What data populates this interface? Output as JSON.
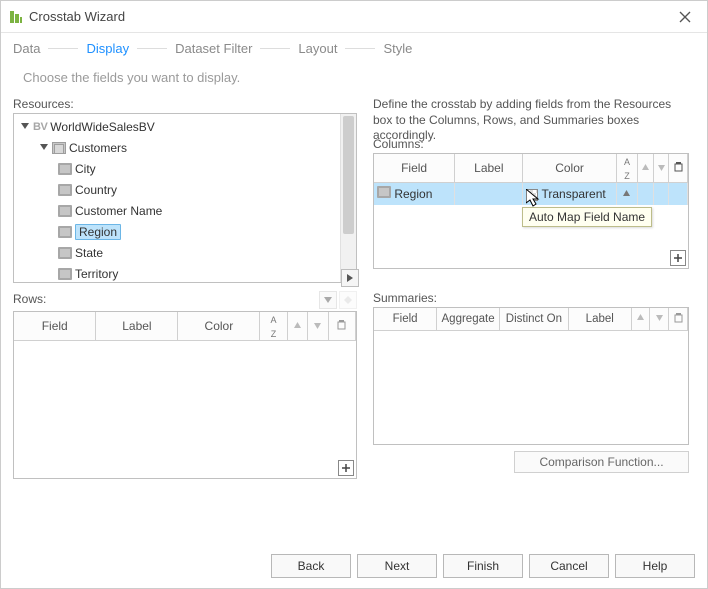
{
  "window": {
    "title": "Crosstab Wizard"
  },
  "steps": [
    "Data",
    "Display",
    "Dataset Filter",
    "Layout",
    "Style"
  ],
  "active_step_index": 1,
  "subtitle": "Choose the fields you want to display.",
  "resources": {
    "label": "Resources:",
    "root": "WorldWideSalesBV",
    "group": "Customers",
    "fields": [
      "City",
      "Country",
      "Customer Name",
      "Region",
      "State",
      "Territory"
    ],
    "selected_field": "Region"
  },
  "description": "Define the crosstab by adding fields from the Resources box to the Columns, Rows, and Summaries boxes accordingly.",
  "columns": {
    "label": "Columns:",
    "headers": [
      "Field",
      "Label",
      "Color"
    ],
    "row": {
      "field": "Region",
      "label": "",
      "color": "Transparent"
    },
    "tooltip": "Auto Map Field Name",
    "sort_icon": "A↓Z"
  },
  "rows": {
    "label": "Rows:",
    "headers": [
      "Field",
      "Label",
      "Color"
    ],
    "sort_icon": "A↓Z"
  },
  "summaries": {
    "label": "Summaries:",
    "headers": [
      "Field",
      "Aggregate",
      "Distinct On",
      "Label"
    ],
    "button": "Comparison Function..."
  },
  "buttons": {
    "back": "Back",
    "next": "Next",
    "finish": "Finish",
    "cancel": "Cancel",
    "help": "Help"
  }
}
